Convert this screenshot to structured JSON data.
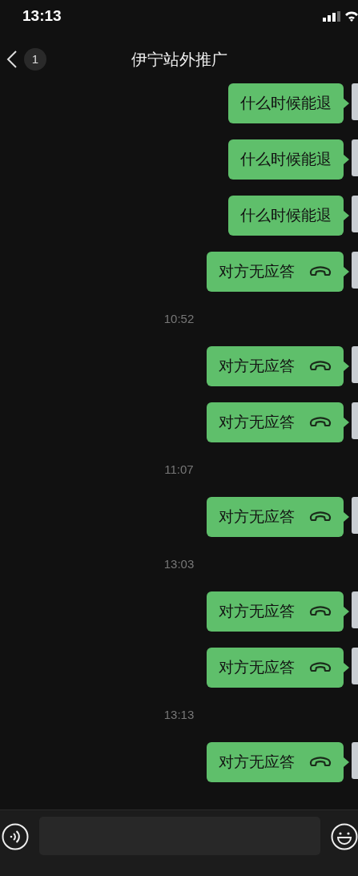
{
  "status_bar": {
    "time": "13:13"
  },
  "header": {
    "back_badge": "1",
    "title": "伊宁站外推广"
  },
  "messages": [
    {
      "kind": "text",
      "text": "什么时候能退"
    },
    {
      "kind": "text",
      "text": "什么时候能退"
    },
    {
      "kind": "text",
      "text": "什么时候能退"
    },
    {
      "kind": "call",
      "text": "对方无应答"
    },
    {
      "kind": "time",
      "text": "10:52"
    },
    {
      "kind": "call",
      "text": "对方无应答"
    },
    {
      "kind": "call",
      "text": "对方无应答"
    },
    {
      "kind": "time",
      "text": "11:07"
    },
    {
      "kind": "call",
      "text": "对方无应答"
    },
    {
      "kind": "time",
      "text": "13:03"
    },
    {
      "kind": "call",
      "text": "对方无应答"
    },
    {
      "kind": "call",
      "text": "对方无应答"
    },
    {
      "kind": "time",
      "text": "13:13"
    },
    {
      "kind": "call",
      "text": "对方无应答"
    }
  ]
}
